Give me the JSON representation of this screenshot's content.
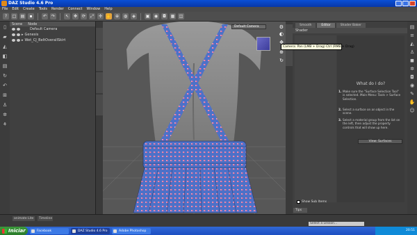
{
  "window": {
    "title": "DAZ Studio 4.6 Pro"
  },
  "menu": [
    "File",
    "Edit",
    "Create",
    "Tools",
    "Render",
    "Connect",
    "Window",
    "Help"
  ],
  "scene": {
    "tabs": [
      "Scene",
      "Node"
    ],
    "items": [
      {
        "label": "Default Camera"
      },
      {
        "label": "Genesis"
      },
      {
        "label": "Wet_CJ_BeltOverallSkirt"
      }
    ]
  },
  "viewport": {
    "camera": "Default Camera"
  },
  "tooltip": "Camera: Pan (LMB + Drag) Ctrl (RMB + Drag)",
  "panel": {
    "tabs": [
      {
        "label": "Smooth"
      },
      {
        "label": "Editor",
        "active": true
      },
      {
        "label": "Shader Baker"
      }
    ],
    "subheader": "Shader",
    "what_do": "What do I do?",
    "steps": [
      {
        "num": "1.",
        "text": "Make sure the \"Surface Selection Tool\" is selected. Main Menu: Tools > Surface Selection."
      },
      {
        "num": "2.",
        "text": "Select a surface on an object in the scene."
      },
      {
        "num": "3.",
        "text": "Select a material group from the list on the left, then adjust the property controls that will show up here."
      }
    ],
    "view_surfaces": "View: Surfaces",
    "show_sub_items": "Show Sub Items",
    "tips": "Tips"
  },
  "bottom": {
    "tab1": "animate Lite",
    "tab2": "Timeline",
    "lesson": "Select a Lesson..."
  },
  "taskbar": {
    "start": "Iniciar",
    "tasks": [
      {
        "label": "Facebook"
      },
      {
        "label": "DAZ Studio 4.6 Pro",
        "active": true
      },
      {
        "label": "Adobe Photoshop"
      }
    ],
    "clock": "20:51"
  },
  "colors": {
    "fabric": "#4d71c8",
    "dots": "#e46a96",
    "accent": "#e6a53a"
  }
}
